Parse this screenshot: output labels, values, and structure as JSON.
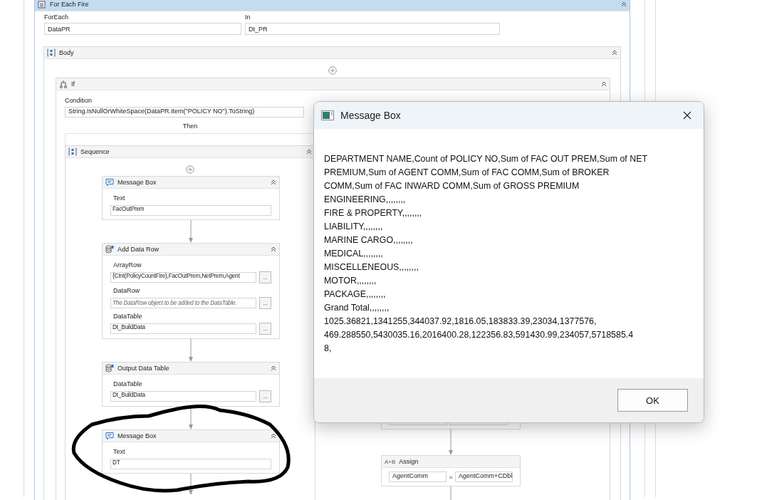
{
  "for_each": {
    "title": "For Each Fire",
    "fields": [
      {
        "label": "ForEach",
        "value": "DataPR"
      },
      {
        "label": "In",
        "value": "Dt_PR"
      }
    ]
  },
  "body": {
    "title": "Body"
  },
  "if": {
    "title": "If",
    "condition_label": "Condition",
    "condition": "String.IsNullOrWhiteSpace(DataPR.Item(\"POLICY NO\").ToString)",
    "then_label": "Then"
  },
  "sequence": {
    "title": "Sequence",
    "activities": [
      {
        "kind": "message_box",
        "title": "Message Box",
        "fields": [
          {
            "label": "Text",
            "value": "FacOutPrem"
          }
        ]
      },
      {
        "kind": "data_row",
        "title": "Add Data Row",
        "fields": [
          {
            "label": "ArrayRow",
            "value": "{CInt(PolicyCountFire),FacOutPrem,NetPrem,Agent",
            "button": "..."
          },
          {
            "label": "DataRow",
            "placeholder": "The DataRow object to be added to the DataTable.",
            "button": "..."
          },
          {
            "label": "DataTable",
            "value": "Dt_BuildData",
            "button": "..."
          }
        ]
      },
      {
        "kind": "data_row",
        "title": "Output Data Table",
        "fields": [
          {
            "label": "DataTable",
            "value": "Dt_BuildData",
            "button": "..."
          }
        ]
      },
      {
        "kind": "message_box",
        "title": "Message Box",
        "fields": [
          {
            "label": "Text",
            "value": "DT"
          }
        ]
      }
    ]
  },
  "assign": {
    "badge": "A+B",
    "title": "Assign",
    "to": "AgentComm",
    "equals": "=",
    "value": "AgentComm+CDbl"
  },
  "dialog": {
    "title": "Message Box",
    "message": "DEPARTMENT NAME,Count of POLICY NO,Sum of FAC OUT PREM,Sum of NET\nPREMIUM,Sum of AGENT COMM,Sum of FAC COMM,Sum of BROKER\nCOMM,Sum of FAC INWARD COMM,Sum of GROSS PREMIUM\nENGINEERING,,,,,,,,\nFIRE & PROPERTY,,,,,,,,\nLIABILITY,,,,,,,,\nMARINE CARGO,,,,,,,,\nMEDICAL,,,,,,,,\nMISCELLENEOUS,,,,,,,,\nMOTOR,,,,,,,,\nPACKAGE,,,,,,,,\nGrand Total,,,,,,,,\n1025.36821,1341255,344037.92,1816.05,183833.39,23034,1377576,\n469.288550,5430035.16,2016400.28,122356.83,591430.99,234057,5718585.4\n8,",
    "ok": "OK"
  }
}
